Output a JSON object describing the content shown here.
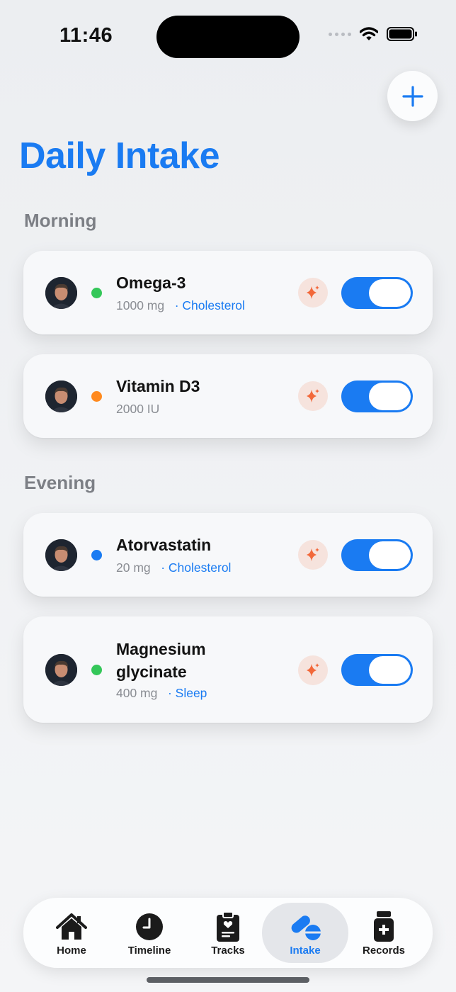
{
  "status_bar": {
    "time": "11:46"
  },
  "header": {
    "title": "Daily Intake",
    "add_button_icon": "plus-icon"
  },
  "sections": [
    {
      "title": "Morning",
      "items": [
        {
          "name": "Omega-3",
          "dose": "1000 mg",
          "tag": "· Cholesterol",
          "dot_color": "#34c759",
          "enabled": true
        },
        {
          "name": "Vitamin D3",
          "dose": "2000 IU",
          "tag": "",
          "dot_color": "#ff8a1f",
          "enabled": true
        }
      ]
    },
    {
      "title": "Evening",
      "items": [
        {
          "name": "Atorvastatin",
          "dose": "20 mg",
          "tag": "· Cholesterol",
          "dot_color": "#1a7bf2",
          "enabled": true
        },
        {
          "name": "Magnesium glycinate",
          "dose": "400 mg",
          "tag": "· Sleep",
          "dot_color": "#34c759",
          "enabled": true
        }
      ]
    }
  ],
  "tab_bar": {
    "tabs": [
      {
        "label": "Home",
        "icon": "home-icon"
      },
      {
        "label": "Timeline",
        "icon": "clock-icon"
      },
      {
        "label": "Tracks",
        "icon": "clipboard-heart-icon"
      },
      {
        "label": "Intake",
        "icon": "pills-icon",
        "active": true
      },
      {
        "label": "Records",
        "icon": "medicine-bottle-icon"
      }
    ]
  },
  "colors": {
    "accent": "#1a7bf2",
    "sparkle": "#f2683a",
    "background": "#eef0f2"
  }
}
